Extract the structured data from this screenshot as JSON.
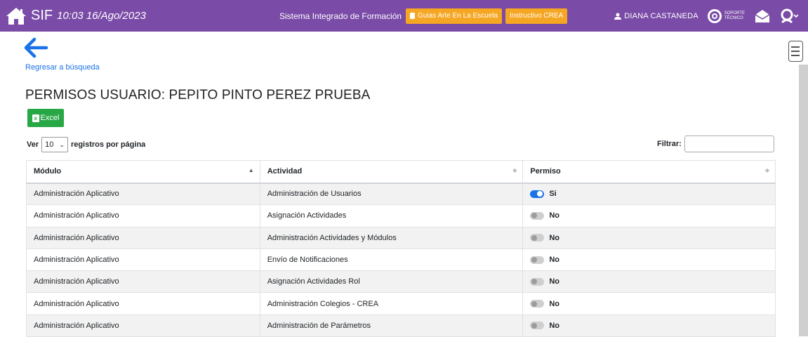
{
  "header": {
    "brand": "SIF",
    "datetime": "10:03 16/Ago/2023",
    "system_title": "Sistema Integrado de Formación",
    "btn_guias": "Guias Arte En La Escuela",
    "btn_instructivo": "Instructivo CREA",
    "username": "DIANA CASTANEDA",
    "support_line1": "SOPORTE",
    "support_line2": "TÉCNICO",
    "bar_color": "#7a4ba7",
    "button_color": "#f5a623"
  },
  "nav": {
    "back_label": "Regresar a búsqueda"
  },
  "page": {
    "title": "PERMISOS USUARIO: PEPITO PINTO PEREZ PRUEBA",
    "excel_label": "Excel",
    "length_prefix": "Ver",
    "length_value": "10",
    "length_suffix": "registros por página",
    "filter_label": "Filtrar:",
    "filter_value": ""
  },
  "table": {
    "columns": [
      "Módulo",
      "Actividad",
      "Permiso"
    ],
    "rows": [
      {
        "modulo": "Administración Aplicativo",
        "actividad": "Administración de Usuarios",
        "permiso": "Si",
        "on": true
      },
      {
        "modulo": "Administración Aplicativo",
        "actividad": "Asignación Actividades",
        "permiso": "No",
        "on": false
      },
      {
        "modulo": "Administración Aplicativo",
        "actividad": "Administración Actividades y Módulos",
        "permiso": "No",
        "on": false
      },
      {
        "modulo": "Administración Aplicativo",
        "actividad": "Envío de Notificaciones",
        "permiso": "No",
        "on": false
      },
      {
        "modulo": "Administración Aplicativo",
        "actividad": "Asignación Actividades Rol",
        "permiso": "No",
        "on": false
      },
      {
        "modulo": "Administración Aplicativo",
        "actividad": "Administración Colegios - CREA",
        "permiso": "No",
        "on": false
      },
      {
        "modulo": "Administración Aplicativo",
        "actividad": "Administración de Parámetros",
        "permiso": "No",
        "on": false
      }
    ]
  },
  "icons": [
    "home-icon",
    "user-icon",
    "support-logo-icon",
    "mail-icon",
    "user-menu-icon",
    "back-arrow-icon",
    "menu-icon",
    "excel-icon"
  ]
}
